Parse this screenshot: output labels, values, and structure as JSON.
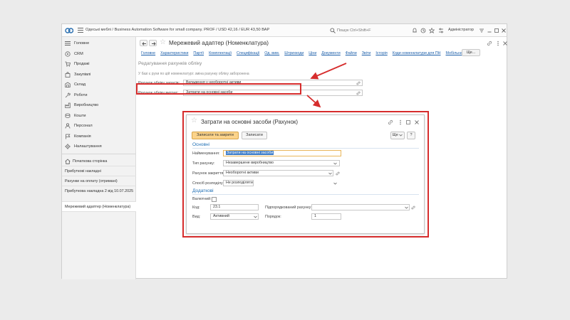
{
  "titlebar": {
    "app_title": "Одеські меблі / Business Automation Software for small company. PROF / USD 42,16 / EUR 43,50 ВАР",
    "search_placeholder": "Пошук Ctrl+Shift+F",
    "user": "Адміністратор"
  },
  "sidebar": {
    "sections": [
      {
        "label": "Головне",
        "icon": "menu-lines-icon"
      },
      {
        "label": "CRM",
        "icon": "crm-icon"
      },
      {
        "label": "Продажі",
        "icon": "cart-icon"
      },
      {
        "label": "Закупівлі",
        "icon": "purchase-icon"
      },
      {
        "label": "Склад",
        "icon": "warehouse-icon"
      },
      {
        "label": "Роботи",
        "icon": "wrench-icon"
      },
      {
        "label": "Виробництво",
        "icon": "factory-icon"
      },
      {
        "label": "Кошти",
        "icon": "coins-icon"
      },
      {
        "label": "Персонал",
        "icon": "person-icon"
      },
      {
        "label": "Компанія",
        "icon": "flag-icon"
      },
      {
        "label": "Налаштування",
        "icon": "gear-icon"
      }
    ],
    "open": [
      {
        "label": "Початкова сторінка",
        "icon": "home-icon"
      },
      {
        "label": "Прибуткові накладні"
      },
      {
        "label": "Рахунки на оплату (отримані)"
      },
      {
        "label": "Прибуткова накладна 2 від 10.07.2025"
      },
      {
        "label": "Мережевий адаптер (Номенклатура)"
      }
    ]
  },
  "form": {
    "title": "Мережевий адаптер (Номенклатура)",
    "nav_links": [
      "Головне",
      "Характеристики",
      "Партії",
      "Комплектації",
      "Специфікації",
      "Од. вим.",
      "Штрихкоди",
      "Ціни",
      "Документи",
      "Файли",
      "Звіти",
      "Історія",
      "Коди номенклатури для ПН",
      "Мобільна каса"
    ],
    "more_label": "Ще...",
    "section_title": "Редагування рахунків обліку",
    "note": "У базі є рухи по цій номенклатурі: зміна рахунку обліку заборонена",
    "rows": [
      {
        "label": "Рахунок обліку запасів:",
        "value": "Вкладення у необоротні активи"
      },
      {
        "label": "Рахунок обліку витрат:",
        "value": "Затрати на основні засоби"
      }
    ]
  },
  "dialog": {
    "title": "Затрати на основні засоби (Рахунок)",
    "save_close": "Записати та закрити",
    "save": "Записати",
    "more": "Ще",
    "help": "?",
    "section_main": "Основні",
    "fields": [
      {
        "label": "Найменування:",
        "value": "Затрати на основні засоби"
      },
      {
        "label": "Тип рахунку:",
        "value": "Незавершене виробництво"
      },
      {
        "label": "Рахунок закриття:",
        "value": "Необоротні активи"
      },
      {
        "label": "Спосіб розподілу:",
        "value": "Не розподіляти"
      }
    ],
    "section_extra": "Додаткові",
    "flags": {
      "label": "Валютний:"
    },
    "code": {
      "label": "Код:",
      "value": "23.1"
    },
    "parent": {
      "label": "Підпорядкований рахунку:",
      "value": ""
    },
    "type": {
      "label": "Вид:",
      "value": "Активний"
    },
    "order": {
      "label": "Порядок:",
      "value": "1"
    }
  },
  "colors": {
    "highlight_red": "#d62c2c",
    "primary_button": "#fbd38a",
    "link_blue": "#1c5faa",
    "section_blue": "#1f6fb5"
  }
}
